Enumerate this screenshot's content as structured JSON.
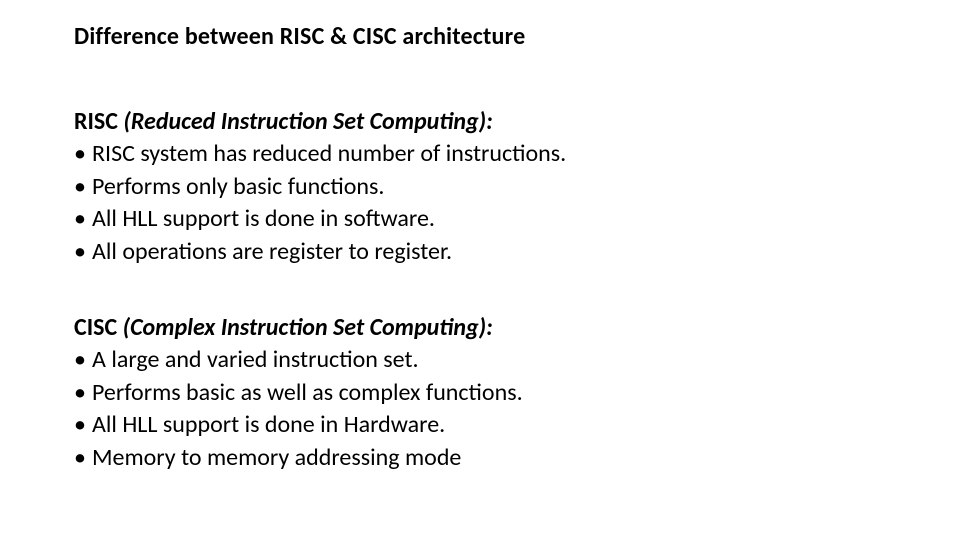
{
  "title": "Difference between RISC & CISC architecture",
  "risc": {
    "name": "RISC",
    "expansion": "(Reduced Instruction Set Computing):",
    "items": [
      "RISC system has reduced number of instructions.",
      "Performs only basic functions.",
      "All HLL support is done in software.",
      "All operations are register to register."
    ]
  },
  "cisc": {
    "name": "CISC",
    "expansion": "(Complex Instruction Set Computing):",
    "items": [
      "A large and varied instruction set.",
      "Performs basic as well as complex functions.",
      "All HLL support is done in Hardware.",
      "Memory to memory addressing mode"
    ]
  },
  "bullet": "•"
}
